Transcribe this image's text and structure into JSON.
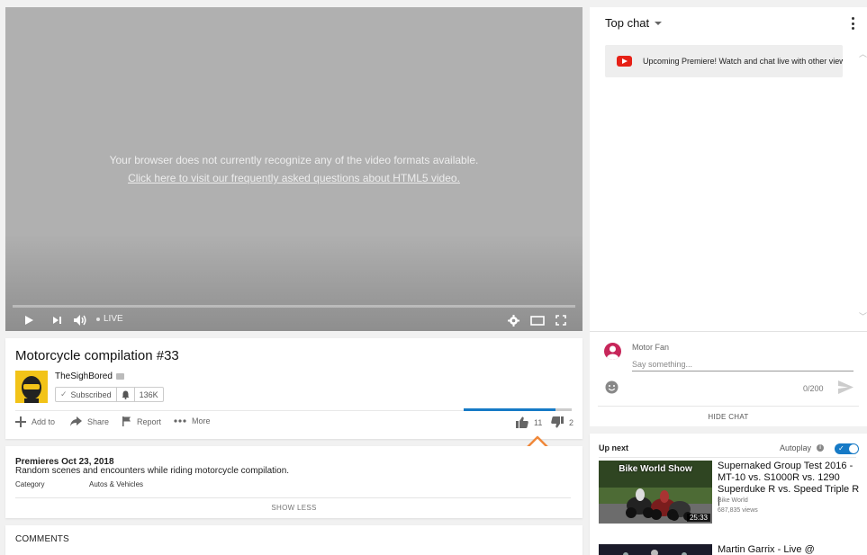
{
  "player": {
    "message": "Your browser does not currently recognize any of the video formats available.",
    "faq_link": "Click here to visit our frequently asked questions about HTML5 video.",
    "live_label": "LIVE"
  },
  "video": {
    "title": "Motorcycle compilation #33",
    "channel": "TheSighBored",
    "subscribe_label": "Subscribed",
    "subscriber_count": "136K",
    "actions": {
      "add_to": "Add to",
      "share": "Share",
      "report": "Report",
      "more": "More"
    },
    "likes": "11",
    "dislikes": "2",
    "like_ratio": 0.85
  },
  "description": {
    "premiere_date": "Premieres Oct 23, 2018",
    "text": "Random scenes and encounters while riding motorcycle compilation.",
    "category_label": "Category",
    "category_value": "Autos & Vehicles",
    "show_less": "SHOW LESS"
  },
  "comments": {
    "title": "COMMENTS"
  },
  "chat": {
    "mode": "Top chat",
    "banner": "Upcoming Premiere! Watch and chat live with other viewers",
    "user_name": "Motor Fan",
    "input_placeholder": "Say something...",
    "char_count": "0/200",
    "hide_label": "HIDE CHAT"
  },
  "up_next": {
    "label": "Up next",
    "autoplay_label": "Autoplay",
    "autoplay_on": true,
    "videos": [
      {
        "thumb_title": "Bike World Show",
        "duration": "25:33",
        "title": "Supernaked Group Test 2016 - MT-10 vs. S1000R vs. 1290 Superduke R vs. Speed Triple R |",
        "channel": "Bike World",
        "views": "687,835 views"
      },
      {
        "title": "Martin Garrix - Live @"
      }
    ]
  },
  "colors": {
    "accent_blue": "#167ac6",
    "youtube_red": "#e62117",
    "annotation_orange": "#f0883a",
    "avatar_yellow": "#f2c318",
    "commenter_avatar": "#c7265a"
  },
  "icons": {
    "player": [
      "play-icon",
      "next-icon",
      "volume-icon",
      "settings-icon",
      "theater-icon",
      "fullscreen-icon"
    ],
    "actions": [
      "plus-icon",
      "share-icon",
      "flag-icon",
      "more-dots-icon",
      "thumbs-up-icon",
      "thumbs-down-icon"
    ],
    "chat": [
      "youtube-logo-icon",
      "emoji-icon",
      "send-icon",
      "kebab-menu-icon"
    ]
  }
}
